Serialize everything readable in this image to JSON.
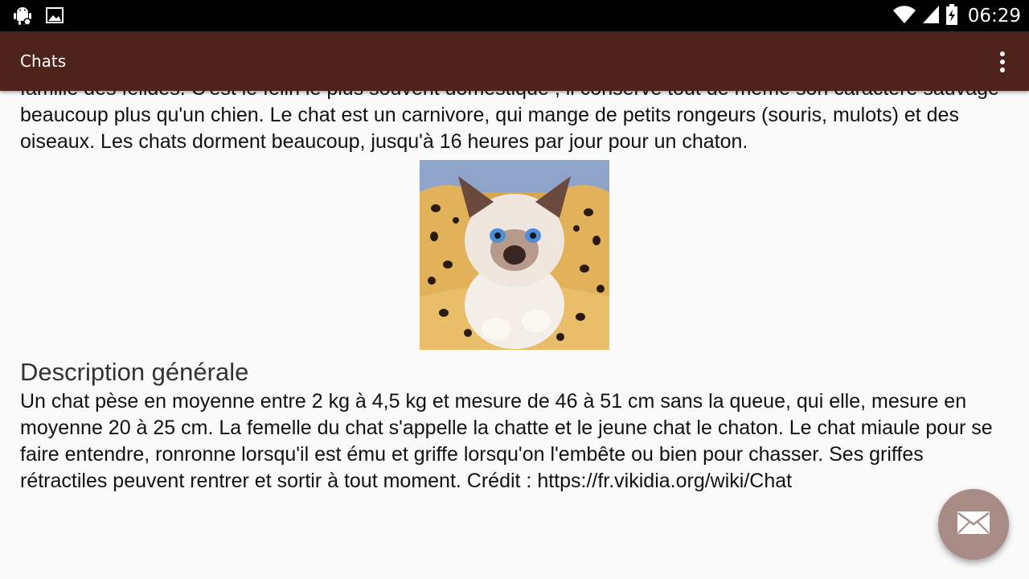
{
  "status_bar": {
    "time": "06:29",
    "icons_left": [
      "android-icon",
      "image-icon"
    ],
    "icons_right": [
      "wifi-icon",
      "signal-icon",
      "battery-icon"
    ]
  },
  "toolbar": {
    "title": "Chats",
    "menu_icon": "overflow-menu-icon",
    "color": "#4e231c"
  },
  "article": {
    "intro_paragraph": "famille des félidés. C'est le félin le plus souvent domestiqué ; il conserve tout de même son caractère sauvage beaucoup plus qu'un chien. Le chat est un carnivore, qui mange de petits rongeurs (souris, mulots) et des oiseaux. Les chats dorment beaucoup, jusqu'à 16 heures par jour pour un chaton.",
    "image_subject": "kitten-photo",
    "section_heading": "Description générale",
    "description_paragraph": "Un chat pèse en moyenne entre 2 kg à 4,5 kg et mesure de 46 à 51 cm sans la queue, qui elle, mesure en moyenne 20 à 25 cm. La femelle du chat s'appelle la chatte et le jeune chat le chaton. Le chat miaule pour se faire entendre, ronronne lorsqu'il est ému et griffe lorsqu'on l'embête ou bien pour chasser. Ses griffes rétractiles peuvent rentrer et sortir à tout moment. Crédit : ",
    "credit_link": "https://fr.vikidia.org/wiki/Chat"
  },
  "fab": {
    "icon": "mail-icon",
    "color": "#a78b84"
  }
}
